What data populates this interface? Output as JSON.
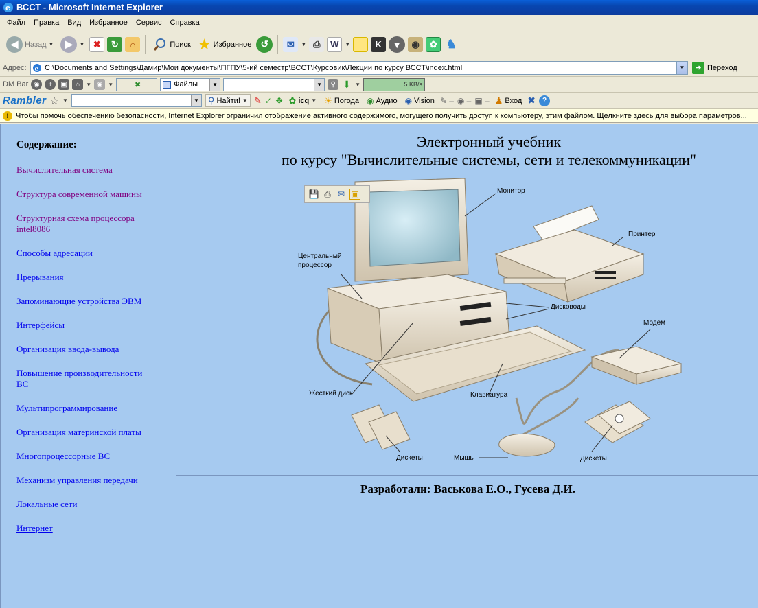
{
  "window": {
    "title": "ВССТ - Microsoft Internet Explorer"
  },
  "menu": [
    "Файл",
    "Правка",
    "Вид",
    "Избранное",
    "Сервис",
    "Справка"
  ],
  "toolbar": {
    "back": "Назад",
    "search": "Поиск",
    "favorites": "Избранное"
  },
  "address": {
    "label": "Адрес:",
    "url": "C:\\Documents and Settings\\Дамир\\Мои документы\\ПГПУ\\5-ий семестр\\ВССТ\\Курсовик\\Лекции по курсу ВССТ\\index.html",
    "go": "Переход"
  },
  "dmbar": {
    "label": "DM Bar",
    "files": "Файлы",
    "speed": "5 KB/s"
  },
  "rambler": {
    "logo": "Rambler",
    "find": "Найти!",
    "icq": "icq",
    "weather": "Погода",
    "audio": "Аудио",
    "vision": "Vision",
    "login": "Вход"
  },
  "infobar": {
    "text": "Чтобы помочь обеспечению безопасности, Internet Explorer ограничил отображение активного содержимого, могущего получить доступ к компьютеру, этим файлом. Щелкните здесь для выбора параметров..."
  },
  "page": {
    "toc_title": "Содержание:",
    "toc": [
      "Вычислительная система",
      "Структура современной машины",
      "Структурная схема процессора intel8086",
      "Способы адресации",
      "Прерывания",
      "Запоминающие устройства ЭВМ",
      "Интерфейсы",
      "Организация ввода-вывода",
      "Повышение производительности ВС",
      "Мультипрограммирование",
      "Организация материнской платы",
      "Многопроцессорные ВС",
      "Механизм управления передачи",
      "Локальные сети",
      "Интернет"
    ],
    "heading_line1": "Электронный учебник",
    "heading_line2": "по курсу \"Вычислительные системы, сети и телекоммуникации\"",
    "labels": {
      "monitor": "Монитор",
      "printer": "Принтер",
      "cpu": "Центральный процессор",
      "drives": "Дисководы",
      "modem": "Модем",
      "hdd": "Жесткий диск",
      "keyboard": "Клавиатура",
      "floppies_left": "Дискеты",
      "mouse": "Мышь",
      "floppies_right": "Дискеты"
    },
    "footer": "Разработали: Васькова Е.О., Гусева Д.И."
  }
}
